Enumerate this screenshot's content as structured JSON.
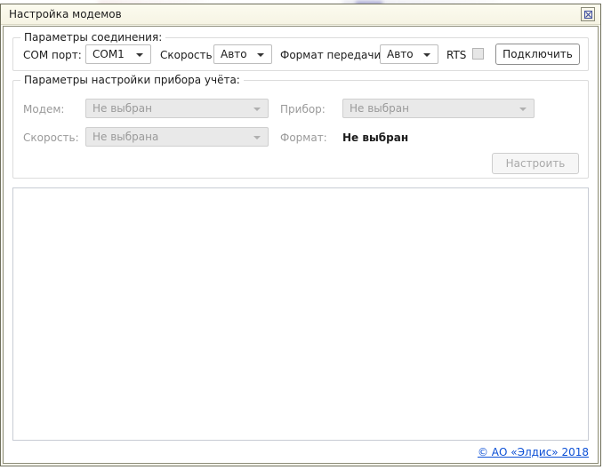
{
  "window": {
    "title": "Настройка модемов",
    "close_label": "✕"
  },
  "connection_group": {
    "legend": "Параметры соединения:",
    "com_port_label": "COM порт:",
    "com_port_value": "COM1",
    "speed_label": "Скорость:",
    "speed_value": "Авто",
    "format_label": "Формат передачи:",
    "format_value": "Авто",
    "rts_label": "RTS",
    "connect_button": "Подключить"
  },
  "device_group": {
    "legend": "Параметры настройки прибора учёта:",
    "modem_label": "Модем:",
    "modem_value": "Не выбран",
    "device_label": "Прибор:",
    "device_value": "Не выбран",
    "speed_label": "Скорость:",
    "speed_value": "Не выбрана",
    "format_label": "Формат:",
    "format_value": "Не выбран",
    "configure_button": "Настроить"
  },
  "footer": {
    "copyright": "© АО «Элдис» 2018"
  },
  "colors": {
    "link": "#0b4fd6",
    "title_bar": "#faf9ec",
    "window_border": "#6f6f5c",
    "disabled_text": "#9a9a9a",
    "disabled_field": "#e9e9e9"
  }
}
